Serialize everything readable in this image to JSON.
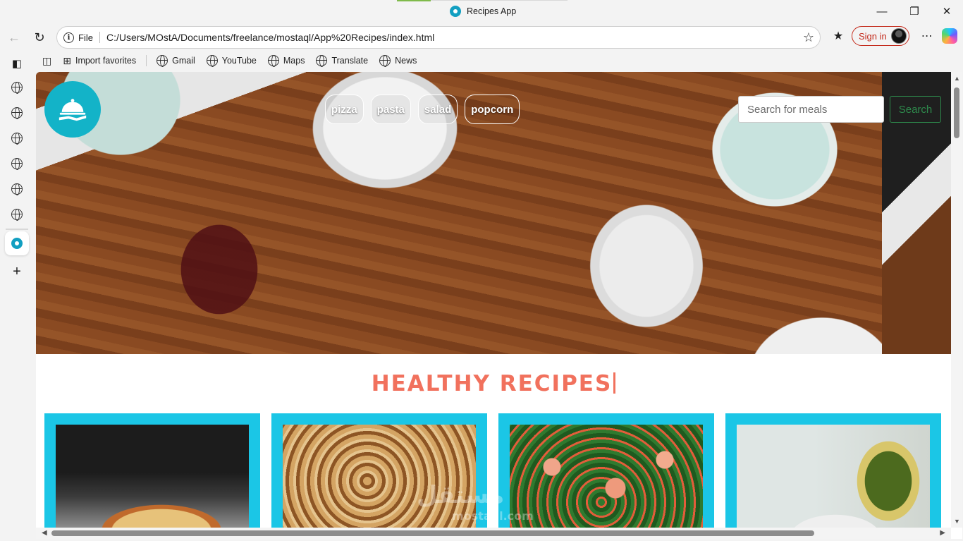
{
  "window": {
    "title": "Recipes App",
    "controls": {
      "minimize": "—",
      "restore": "❐",
      "close": "✕"
    }
  },
  "addressbar": {
    "label": "File",
    "url": "C:/Users/MOstA/Documents/freelance/mostaql/App%20Recipes/index.html",
    "signin_label": "Sign in"
  },
  "favorites": {
    "import_label": "Import favorites",
    "items": [
      "Gmail",
      "YouTube",
      "Maps",
      "Translate",
      "News"
    ]
  },
  "page": {
    "categories": [
      "pizza",
      "pasta",
      "salad",
      "popcorn"
    ],
    "search": {
      "placeholder": "Search for meals",
      "button_label": "Search"
    },
    "section_title": "HEALTHY RECIPES",
    "colors": {
      "accent_title": "#f1715d",
      "card_bg": "#1bc6e6",
      "logo_bg": "#13b3c8",
      "search_btn": "#2e8a4c"
    },
    "watermark": {
      "arabic": "مستقل",
      "latin": "mostaql.com"
    }
  }
}
